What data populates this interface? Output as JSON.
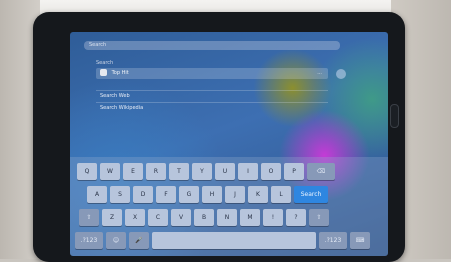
{
  "search": {
    "placeholder": "Search"
  },
  "results": {
    "section_label": "Search",
    "top_hit": {
      "label": "Top Hit",
      "more": "..."
    },
    "links": [
      "Search Web",
      "Search Wikipedia"
    ]
  },
  "keyboard": {
    "row1": [
      "Q",
      "W",
      "E",
      "R",
      "T",
      "Y",
      "U",
      "I",
      "O",
      "P"
    ],
    "row1_delete": "⌫",
    "row2": [
      "A",
      "S",
      "D",
      "F",
      "G",
      "H",
      "J",
      "K",
      "L"
    ],
    "row2_action": "Search",
    "row3_shift_left": "⇧",
    "row3": [
      "Z",
      "X",
      "C",
      "V",
      "B",
      "N",
      "M",
      "!",
      "?"
    ],
    "row3_shift_right": "⇧",
    "row4_numbers_left": ".?123",
    "row4_emoji": "☺",
    "row4_mic": "🎤",
    "row4_space": "",
    "row4_numbers_right": ".?123",
    "row4_hide": "⌨"
  }
}
